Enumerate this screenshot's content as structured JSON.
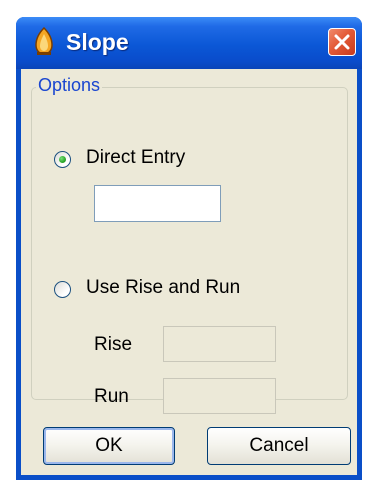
{
  "window": {
    "title": "Slope",
    "app_icon": "bell-flame-icon",
    "close_icon": "close-icon"
  },
  "options": {
    "legend": "Options",
    "direct_entry": {
      "label": "Direct Entry",
      "selected": true,
      "value": ""
    },
    "rise_and_run": {
      "label": "Use Rise and Run",
      "selected": false,
      "rise_label": "Rise",
      "rise_value": "",
      "run_label": "Run",
      "run_value": ""
    }
  },
  "buttons": {
    "ok": "OK",
    "cancel": "Cancel"
  },
  "colors": {
    "title_bar": "#0b57d6",
    "close_button": "#e35a37",
    "dialog_face": "#ece9d8",
    "group_legend": "#1a46d0"
  }
}
